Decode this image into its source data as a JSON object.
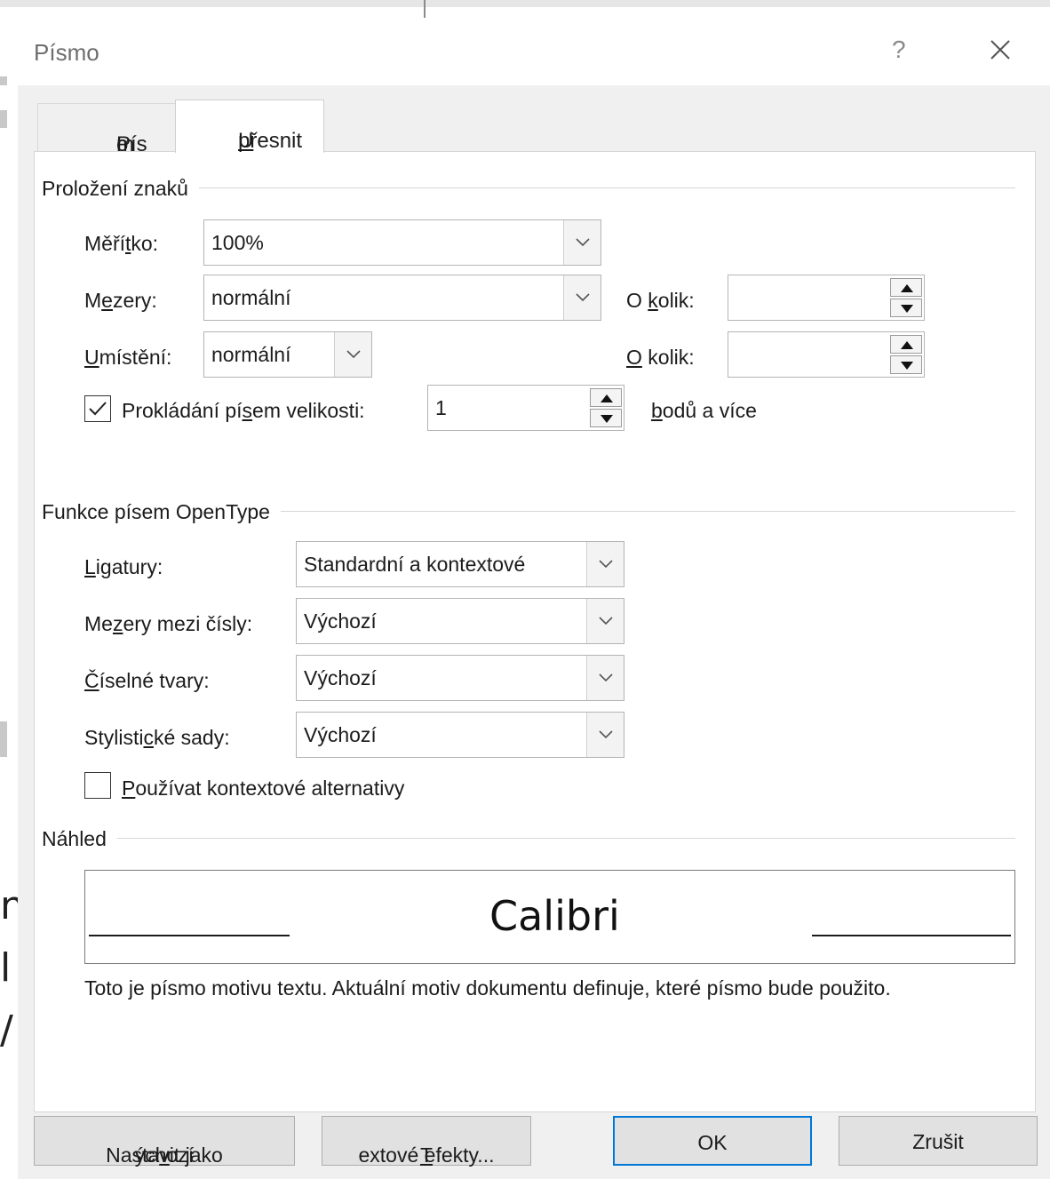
{
  "dialog": {
    "title": "Písmo",
    "help_label": "?"
  },
  "tabs": [
    {
      "label_pre": "Pís",
      "label_acc": "m",
      "label_post": "o",
      "active": false
    },
    {
      "label_pre": "",
      "label_acc": "U",
      "label_post": "přesnit",
      "active": true
    }
  ],
  "spacing_group": {
    "title": "Proložení znaků",
    "scale": {
      "label_pre": "Měří",
      "label_acc": "t",
      "label_post": "ko:",
      "value": "100%"
    },
    "spacing": {
      "label_pre": "M",
      "label_acc": "e",
      "label_post": "zery:",
      "value": "normální"
    },
    "position": {
      "label_pre": "",
      "label_acc": "U",
      "label_post": "místění:",
      "value": "normální"
    },
    "by1": {
      "label_pre": "O ",
      "label_acc": "k",
      "label_post": "olik:",
      "value": ""
    },
    "by2": {
      "label_pre": "",
      "label_acc": "O",
      "label_post": " kolik:",
      "value": ""
    },
    "kerning": {
      "checked": true,
      "label_pre": "Prokládání pí",
      "label_acc": "s",
      "label_post": "em velikosti:",
      "value": "1",
      "suffix_acc": "b",
      "suffix_post": "odů a více"
    }
  },
  "opentype_group": {
    "title": "Funkce písem OpenType",
    "ligatures": {
      "label_pre": "",
      "label_acc": "L",
      "label_post": "igatury:",
      "value": "Standardní a kontextové"
    },
    "number_spacing": {
      "label_pre": "Me",
      "label_acc": "z",
      "label_post": "ery mezi čísly:",
      "value": "Výchozí"
    },
    "number_forms": {
      "label_pre": "",
      "label_acc": "Č",
      "label_post": "íselné tvary:",
      "value": "Výchozí"
    },
    "stylistic_sets": {
      "label_pre": "Stylisti",
      "label_acc": "c",
      "label_post": "ké sady:",
      "value": "Výchozí"
    },
    "contextual": {
      "checked": false,
      "label_pre": "",
      "label_acc": "P",
      "label_post": "oužívat kontextové alternativy"
    }
  },
  "preview_group": {
    "title": "Náhled",
    "sample": "Calibri",
    "note": "Toto je písmo motivu textu. Aktuální motiv dokumentu definuje, které písmo bude použito."
  },
  "buttons": {
    "set_default": {
      "label_pre": "Nastavit jako ",
      "label_acc": "v",
      "label_post": "ýchozí"
    },
    "text_effects": {
      "label_pre": "",
      "label_acc": "T",
      "label_post": "extové efekty..."
    },
    "ok": "OK",
    "cancel": "Zrušit"
  },
  "background_letters": [
    "n",
    "l",
    "/"
  ],
  "colors": {
    "accent": "#0078d7",
    "dialog_bg": "#f0f0f0",
    "panel_bg": "#ffffff"
  }
}
